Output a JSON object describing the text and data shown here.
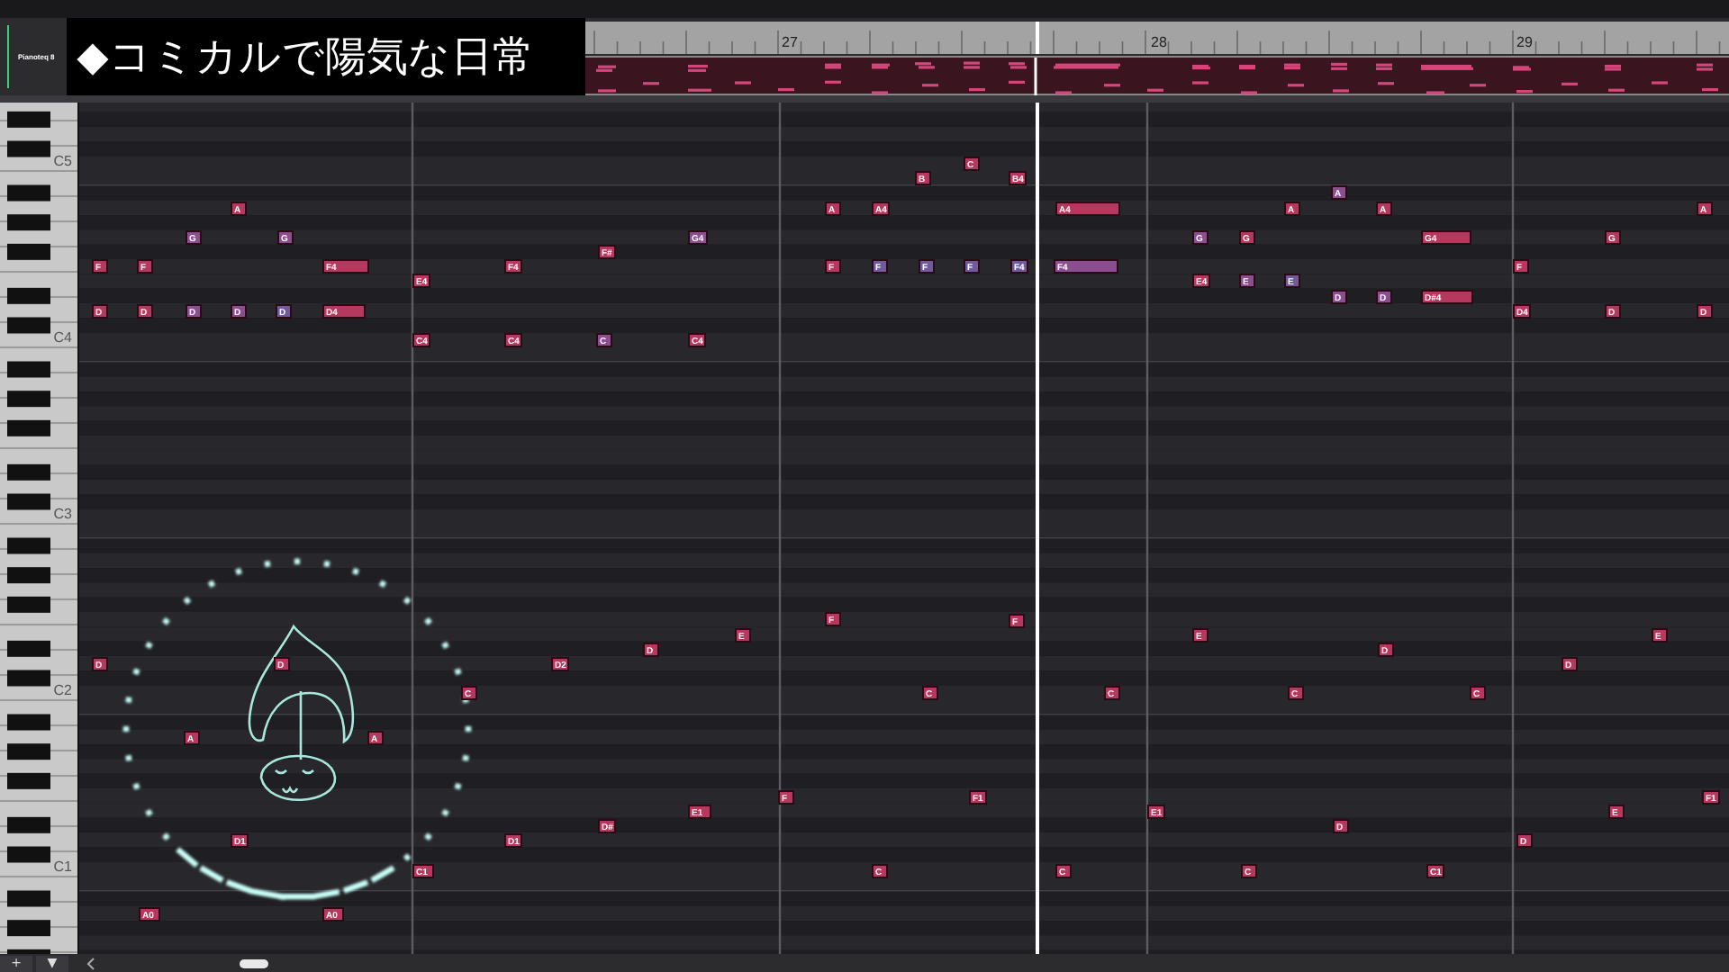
{
  "track": {
    "name": "Pianoteq 8"
  },
  "title_overlay": "◆コミカルで陽気な日常",
  "ruler": {
    "bars": [
      "27",
      "28",
      "29"
    ]
  },
  "keyboard": {
    "octave_labels": [
      "C5",
      "C4",
      "C3",
      "C2",
      "C1"
    ]
  },
  "notes": [
    {
      "label": "A",
      "color": "#b5395f"
    },
    {
      "label": "G",
      "color": "#8b4f8f"
    },
    {
      "label": "G",
      "color": "#8b4f8f"
    },
    {
      "label": "F",
      "color": "#b5395f"
    },
    {
      "label": "F",
      "color": "#b5395f"
    },
    {
      "label": "F4",
      "color": "#b5395f"
    },
    {
      "label": "D",
      "color": "#b5395f"
    },
    {
      "label": "D",
      "color": "#b5395f"
    },
    {
      "label": "D",
      "color": "#8b4f8f"
    },
    {
      "label": "D",
      "color": "#8b4f8f"
    },
    {
      "label": "D",
      "color": "#6f5a9c"
    },
    {
      "label": "D4",
      "color": "#b5395f"
    },
    {
      "label": "E4",
      "color": "#b5395f"
    },
    {
      "label": "F4",
      "color": "#b5395f"
    },
    {
      "label": "F#",
      "color": "#b5395f"
    },
    {
      "label": "G4",
      "color": "#8b4f8f"
    },
    {
      "label": "C4",
      "color": "#b5395f"
    },
    {
      "label": "C4",
      "color": "#b5395f"
    },
    {
      "label": "C",
      "color": "#8b4f8f"
    },
    {
      "label": "C4",
      "color": "#b5395f"
    },
    {
      "label": "A",
      "color": "#b5395f"
    },
    {
      "label": "F",
      "color": "#b5395f"
    },
    {
      "label": "A4",
      "color": "#b5395f"
    },
    {
      "label": "B",
      "color": "#b5395f"
    },
    {
      "label": "C",
      "color": "#b5395f"
    },
    {
      "label": "B4",
      "color": "#b5395f"
    },
    {
      "label": "F",
      "color": "#6f5a9c"
    },
    {
      "label": "F",
      "color": "#6f5a9c"
    },
    {
      "label": "F",
      "color": "#6f5a9c"
    },
    {
      "label": "F4",
      "color": "#6f5a9c"
    },
    {
      "label": "A4",
      "color": "#b5395f"
    },
    {
      "label": "F4",
      "color": "#8b4f8f"
    },
    {
      "label": "G",
      "color": "#8b4f8f"
    },
    {
      "label": "G",
      "color": "#b5395f"
    },
    {
      "label": "E4",
      "color": "#b5395f"
    },
    {
      "label": "E",
      "color": "#8b4f8f"
    },
    {
      "label": "A",
      "color": "#b5395f"
    },
    {
      "label": "E",
      "color": "#6f5a9c"
    },
    {
      "label": "A",
      "color": "#8b4f8f"
    },
    {
      "label": "A",
      "color": "#b5395f"
    },
    {
      "label": "D",
      "color": "#8b4f8f"
    },
    {
      "label": "D",
      "color": "#8b4f8f"
    },
    {
      "label": "G4",
      "color": "#b5395f"
    },
    {
      "label": "D#4",
      "color": "#b5395f"
    },
    {
      "label": "F",
      "color": "#b5395f"
    },
    {
      "label": "D4",
      "color": "#b5395f"
    },
    {
      "label": "G",
      "color": "#b5395f"
    },
    {
      "label": "D",
      "color": "#b5395f"
    },
    {
      "label": "A",
      "color": "#b5395f"
    },
    {
      "label": "D",
      "color": "#b5395f"
    },
    {
      "label": "D",
      "color": "#b5395f"
    },
    {
      "label": "D",
      "color": "#b5395f"
    },
    {
      "label": "A",
      "color": "#b5395f"
    },
    {
      "label": "A",
      "color": "#b5395f"
    },
    {
      "label": "D1",
      "color": "#b5395f"
    },
    {
      "label": "A0",
      "color": "#b5395f"
    },
    {
      "label": "A0",
      "color": "#b5395f"
    },
    {
      "label": "C1",
      "color": "#b5395f"
    },
    {
      "label": "C",
      "color": "#b5395f"
    },
    {
      "label": "D2",
      "color": "#b5395f"
    },
    {
      "label": "D",
      "color": "#b5395f"
    },
    {
      "label": "E",
      "color": "#b5395f"
    },
    {
      "label": "F",
      "color": "#b5395f"
    },
    {
      "label": "D1",
      "color": "#b5395f"
    },
    {
      "label": "D#",
      "color": "#b5395f"
    },
    {
      "label": "E1",
      "color": "#b5395f"
    },
    {
      "label": "F",
      "color": "#b5395f"
    },
    {
      "label": "F",
      "color": "#b5395f"
    },
    {
      "label": "C",
      "color": "#b5395f"
    },
    {
      "label": "C",
      "color": "#b5395f"
    },
    {
      "label": "E",
      "color": "#b5395f"
    },
    {
      "label": "C",
      "color": "#b5395f"
    },
    {
      "label": "D",
      "color": "#b5395f"
    },
    {
      "label": "C",
      "color": "#b5395f"
    },
    {
      "label": "D",
      "color": "#b5395f"
    },
    {
      "label": "E",
      "color": "#b5395f"
    },
    {
      "label": "F1",
      "color": "#b5395f"
    },
    {
      "label": "E1",
      "color": "#b5395f"
    },
    {
      "label": "D",
      "color": "#b5395f"
    },
    {
      "label": "D",
      "color": "#b5395f"
    },
    {
      "label": "E",
      "color": "#b5395f"
    },
    {
      "label": "F1",
      "color": "#b5395f"
    },
    {
      "label": "C",
      "color": "#b5395f"
    },
    {
      "label": "C",
      "color": "#b5395f"
    },
    {
      "label": "C",
      "color": "#b5395f"
    },
    {
      "label": "C1",
      "color": "#b5395f"
    }
  ],
  "toolbar": {
    "buttons": [
      "+",
      "▼"
    ]
  }
}
